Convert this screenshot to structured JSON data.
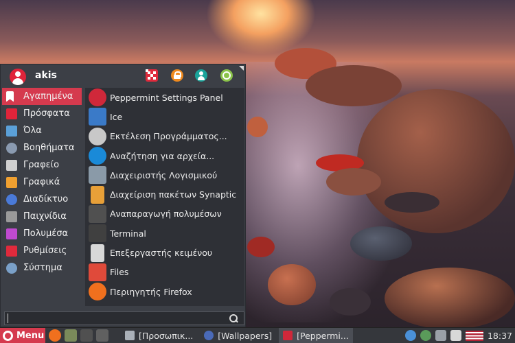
{
  "user": {
    "name": "akis"
  },
  "header_icons": [
    {
      "name": "settings-icon"
    },
    {
      "name": "lock-screen-icon"
    },
    {
      "name": "user-icon"
    },
    {
      "name": "logout-icon"
    }
  ],
  "categories": [
    {
      "label": "Αγαπημένα",
      "icon": "bookmark-icon",
      "color": "#ffffff",
      "active": true
    },
    {
      "label": "Πρόσφατα",
      "icon": "recent-icon",
      "color": "#e0243a"
    },
    {
      "label": "Όλα",
      "icon": "all-apps-icon",
      "color": "#5ba0d8"
    },
    {
      "label": "Βοηθήματα",
      "icon": "accessories-icon",
      "color": "#8a9ab0"
    },
    {
      "label": "Γραφείο",
      "icon": "office-icon",
      "color": "#d0d0d0"
    },
    {
      "label": "Γραφικά",
      "icon": "graphics-icon",
      "color": "#f0a030"
    },
    {
      "label": "Διαδίκτυο",
      "icon": "internet-icon",
      "color": "#4a7ad8"
    },
    {
      "label": "Παιχνίδια",
      "icon": "games-icon",
      "color": "#9a9a9a"
    },
    {
      "label": "Πολυμέσα",
      "icon": "multimedia-icon",
      "color": "#c04ad0"
    },
    {
      "label": "Ρυθμίσεις",
      "icon": "settings-category-icon",
      "color": "#e02a3c"
    },
    {
      "label": "Σύστημα",
      "icon": "system-icon",
      "color": "#7aa0c8"
    }
  ],
  "apps": [
    {
      "label": "Peppermint Settings Panel",
      "icon": "peppermint-icon",
      "color": "#d0283a"
    },
    {
      "label": "Ice",
      "icon": "ice-icon",
      "color": "#3a7ac8"
    },
    {
      "label": "Εκτέλεση Προγράμματος...",
      "icon": "run-program-icon",
      "color": "#c8c8c8"
    },
    {
      "label": "Αναζήτηση για αρχεία...",
      "icon": "file-search-icon",
      "color": "#1a8ad8"
    },
    {
      "label": "Διαχειριστής Λογισμικού",
      "icon": "software-manager-icon",
      "color": "#8a9aa8"
    },
    {
      "label": "Διαχείριση πακέτων Synaptic",
      "icon": "synaptic-icon",
      "color": "#e8a038"
    },
    {
      "label": "Αναπαραγωγή πολυμέσων",
      "icon": "media-player-icon",
      "color": "#505050"
    },
    {
      "label": "Terminal",
      "icon": "terminal-icon",
      "color": "#404040"
    },
    {
      "label": "Επεξεργαστής κειμένου",
      "icon": "text-editor-icon",
      "color": "#d8d8d8"
    },
    {
      "label": "Files",
      "icon": "files-icon",
      "color": "#e04a3a"
    },
    {
      "label": "Περιηγητής Firefox",
      "icon": "firefox-icon",
      "color": "#f0701e"
    }
  ],
  "search": {
    "value": "",
    "placeholder": ""
  },
  "taskbar": {
    "menu_label": "Menu",
    "launchers": [
      {
        "name": "firefox-launcher-icon",
        "color": "#f0701e"
      },
      {
        "name": "files-launcher-icon",
        "color": "#7a8a5a"
      },
      {
        "name": "terminal-launcher-icon",
        "color": "#505050"
      },
      {
        "name": "media-launcher-icon",
        "color": "#606060"
      }
    ],
    "tasks": [
      {
        "label": "[Προσωπικ...",
        "icon": "home-folder-icon",
        "color": "#aab0b8"
      },
      {
        "label": "[Wallpapers]",
        "icon": "wallpapers-icon",
        "color": "#4a6ab8"
      },
      {
        "label": "[Peppermi...",
        "icon": "peppermint-settings-icon",
        "color": "#d0283a",
        "active": true
      }
    ],
    "tray": [
      {
        "name": "shield-icon",
        "color": "#4a90d8"
      },
      {
        "name": "updates-icon",
        "color": "#5a9a5a"
      },
      {
        "name": "display-icon",
        "color": "#9aa0a8"
      },
      {
        "name": "volume-icon",
        "color": "#d8d8d8"
      },
      {
        "name": "us-flag-icon",
        "color": "#b22234"
      }
    ],
    "clock": "18:37"
  }
}
